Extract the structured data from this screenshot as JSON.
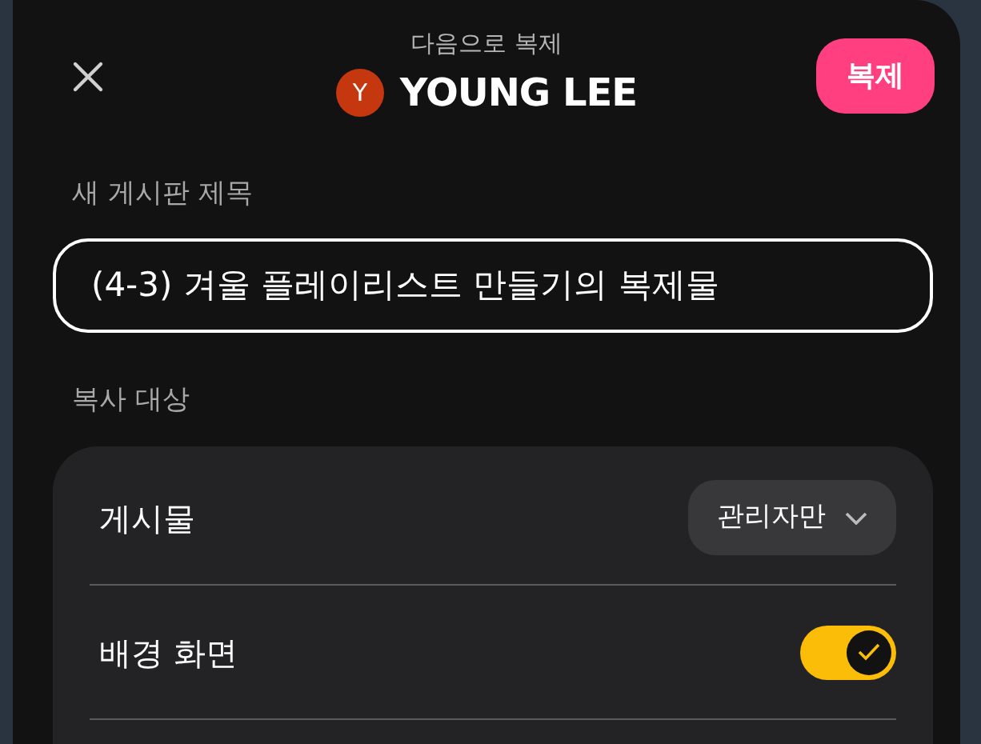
{
  "header": {
    "subtitle": "다음으로 복제",
    "avatar_letter": "Y",
    "account_name": "YOUNG LEE",
    "confirm_button": "복제"
  },
  "title_field": {
    "label": "새 게시판 제목",
    "value": "(4-3) 겨울 플레이리스트 만들기의 복제물"
  },
  "copy_section": {
    "label": "복사 대상",
    "rows": [
      {
        "kind": "dropdown",
        "label": "게시물",
        "value": "관리자만"
      },
      {
        "kind": "toggle",
        "label": "배경 화면",
        "on": true
      }
    ]
  }
}
